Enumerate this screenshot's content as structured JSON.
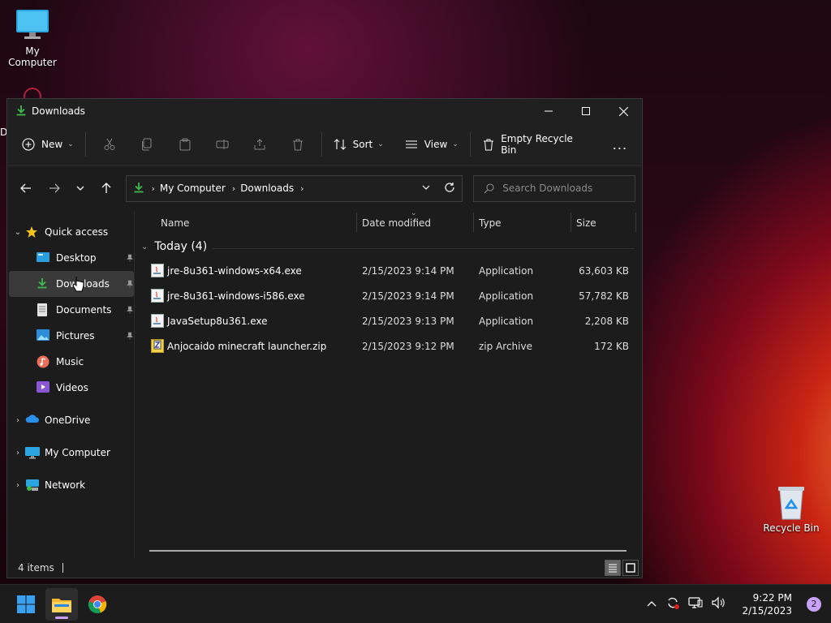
{
  "desktop": {
    "icons": [
      {
        "label": "My Computer"
      },
      {
        "label": "Recycle Bin"
      }
    ],
    "partial_icon_letter": "D"
  },
  "window": {
    "title": "Downloads",
    "toolbar": {
      "new_label": "New",
      "sort_label": "Sort",
      "view_label": "View",
      "empty_recycle_label": "Empty Recycle Bin",
      "more_label": "..."
    },
    "address": {
      "crumbs": [
        "My Computer",
        "Downloads"
      ]
    },
    "search": {
      "placeholder": "Search Downloads"
    },
    "sidebar": {
      "quick_access": "Quick access",
      "items": [
        {
          "label": "Desktop",
          "pinned": true
        },
        {
          "label": "Downloads",
          "pinned": true,
          "selected": true
        },
        {
          "label": "Documents",
          "pinned": true
        },
        {
          "label": "Pictures",
          "pinned": true
        },
        {
          "label": "Music"
        },
        {
          "label": "Videos"
        }
      ],
      "onedrive": "OneDrive",
      "my_computer": "My Computer",
      "network": "Network"
    },
    "columns": {
      "name": "Name",
      "date": "Date modified",
      "type": "Type",
      "size": "Size"
    },
    "group": {
      "label": "Today (4)"
    },
    "files": [
      {
        "name": "jre-8u361-windows-x64.exe",
        "date": "2/15/2023 9:14 PM",
        "type": "Application",
        "size": "63,603 KB",
        "icon": "java-icon"
      },
      {
        "name": "jre-8u361-windows-i586.exe",
        "date": "2/15/2023 9:14 PM",
        "type": "Application",
        "size": "57,782 KB",
        "icon": "java-icon"
      },
      {
        "name": "JavaSetup8u361.exe",
        "date": "2/15/2023 9:13 PM",
        "type": "Application",
        "size": "2,208 KB",
        "icon": "java-icon"
      },
      {
        "name": "Anjocaido minecraft launcher.zip",
        "date": "2/15/2023 9:12 PM",
        "type": "zip Archive",
        "size": "172 KB",
        "icon": "zip-icon"
      }
    ],
    "status": {
      "items": "4 items"
    }
  },
  "taskbar": {
    "time": "9:22 PM",
    "date": "2/15/2023",
    "notification_count": "2"
  },
  "colors": {
    "window_bg": "#1c1c1c",
    "accent": "#c9a1ff",
    "download_green": "#3fb950"
  }
}
